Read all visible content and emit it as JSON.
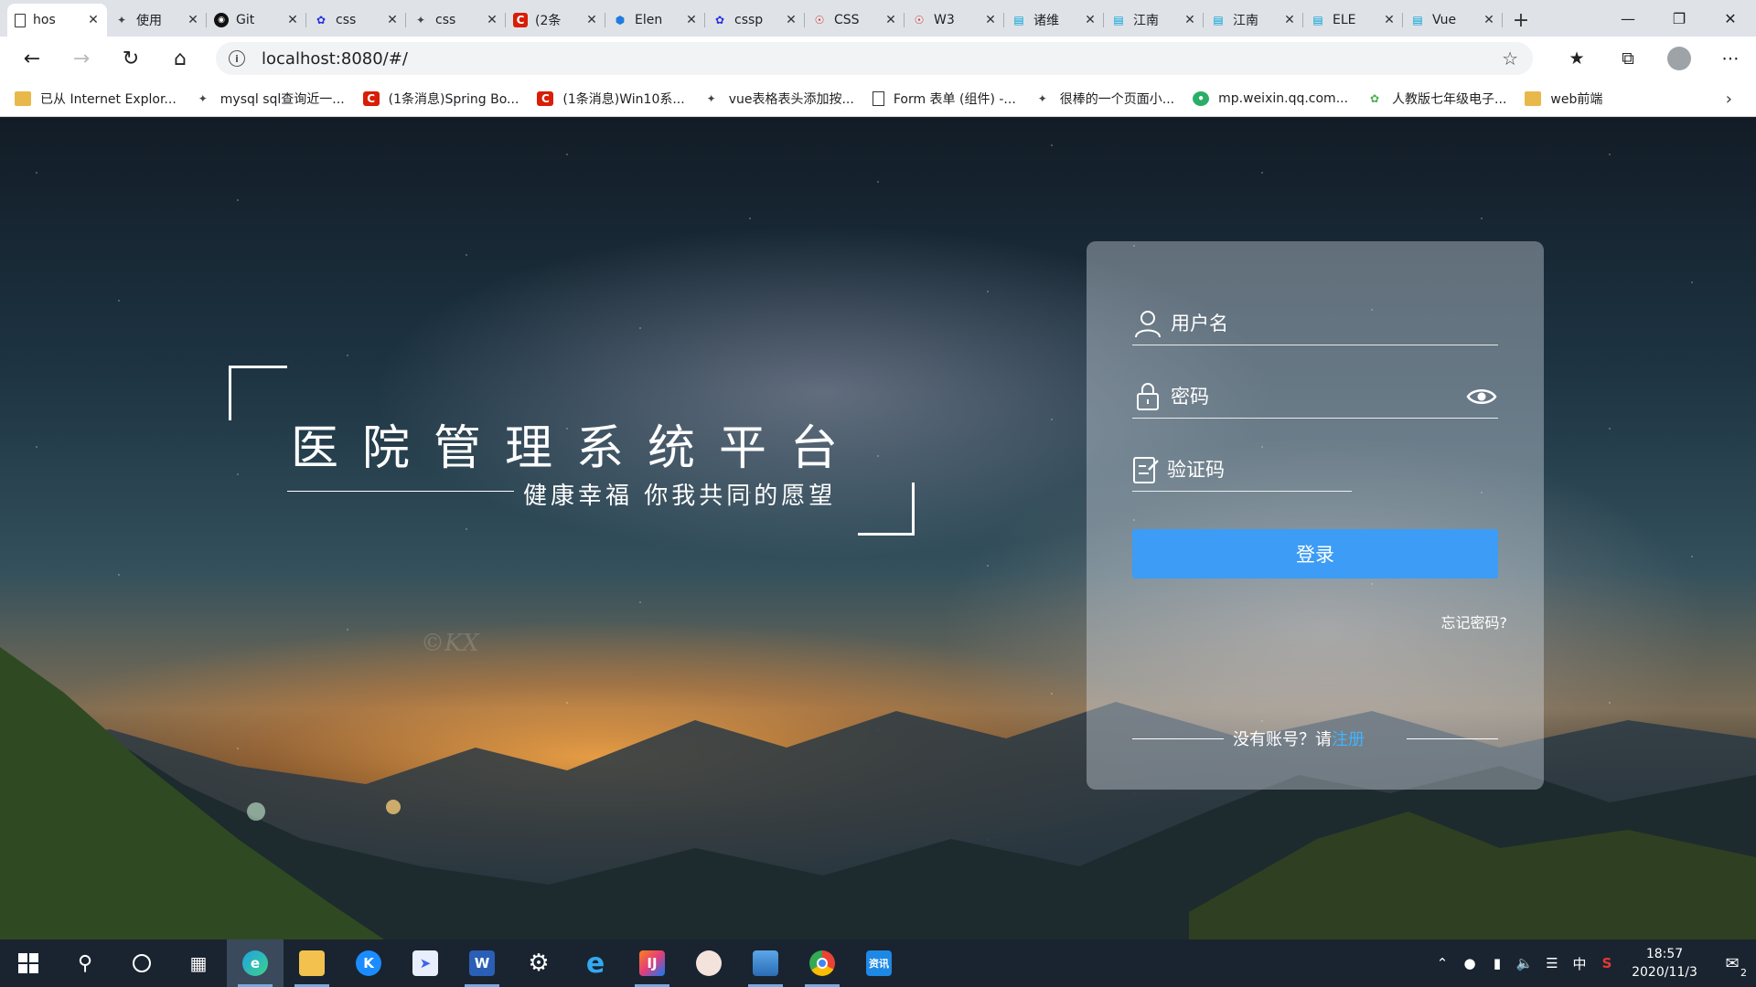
{
  "browser": {
    "tabs": [
      {
        "title": "hos",
        "favicon": "doc-icon",
        "active": true
      },
      {
        "title": "使用",
        "favicon": "yuque-icon"
      },
      {
        "title": "Git",
        "favicon": "github-icon"
      },
      {
        "title": "css",
        "favicon": "baidu-icon"
      },
      {
        "title": "css",
        "favicon": "yuque-icon"
      },
      {
        "title": "(2条",
        "favicon": "csdn-icon"
      },
      {
        "title": "Elen",
        "favicon": "element-icon"
      },
      {
        "title": "cssp",
        "favicon": "baidu-icon"
      },
      {
        "title": "CSS",
        "favicon": "w3-icon"
      },
      {
        "title": "W3",
        "favicon": "w3-icon"
      },
      {
        "title": "诸维",
        "favicon": "bilibili-icon"
      },
      {
        "title": "江南",
        "favicon": "bilibili-icon"
      },
      {
        "title": "江南",
        "favicon": "bilibili-icon"
      },
      {
        "title": "ELE",
        "favicon": "bilibili-icon"
      },
      {
        "title": "Vue",
        "favicon": "bilibili-icon"
      }
    ],
    "close_glyph": "✕",
    "new_tab_glyph": "+",
    "address": {
      "url": "localhost:8080/#/"
    },
    "bookmarks": [
      {
        "label": "已从 Internet Explor...",
        "icon": "folder-icon"
      },
      {
        "label": "mysql sql查询近一...",
        "icon": "yuque-icon"
      },
      {
        "label": "(1条消息)Spring Bo...",
        "icon": "csdn-icon"
      },
      {
        "label": "(1条消息)Win10系...",
        "icon": "csdn-icon"
      },
      {
        "label": "vue表格表头添加按...",
        "icon": "yuque-icon"
      },
      {
        "label": "Form 表单 (组件) -...",
        "icon": "doc-icon"
      },
      {
        "label": "很棒的一个页面小...",
        "icon": "yuque-icon"
      },
      {
        "label": "mp.weixin.qq.com...",
        "icon": "wechat-icon"
      },
      {
        "label": "人教版七年级电子...",
        "icon": "book-icon"
      },
      {
        "label": "web前端",
        "icon": "folder-icon"
      }
    ]
  },
  "hero": {
    "title": "医院管理系统平台",
    "subtitle": "健康幸福 你我共同的愿望",
    "watermark": "©KX"
  },
  "login": {
    "username_placeholder": "用户名",
    "password_placeholder": "密码",
    "code_placeholder": "验证码",
    "login_button": "登录",
    "forgot_password": "忘记密码?",
    "no_account_text": "没有账号？请",
    "register_link": "注册",
    "accent_color": "#3d9cf5",
    "link_color": "#3fb4ff"
  },
  "taskbar": {
    "apps": [
      "windows-start-icon",
      "search-icon",
      "cortana-icon",
      "task-view-icon",
      "edge-icon",
      "file-explorer-icon",
      "kugou-icon",
      "feishu-icon",
      "word-icon",
      "settings-icon",
      "ie-icon",
      "intellij-icon",
      "avatar-app-icon",
      "photos-icon",
      "chrome-icon",
      "news-icon"
    ],
    "news_label": "资讯",
    "word_label": "W",
    "ime": "中",
    "time": "18:57",
    "date": "2020/11/3",
    "notification_count": "2"
  }
}
